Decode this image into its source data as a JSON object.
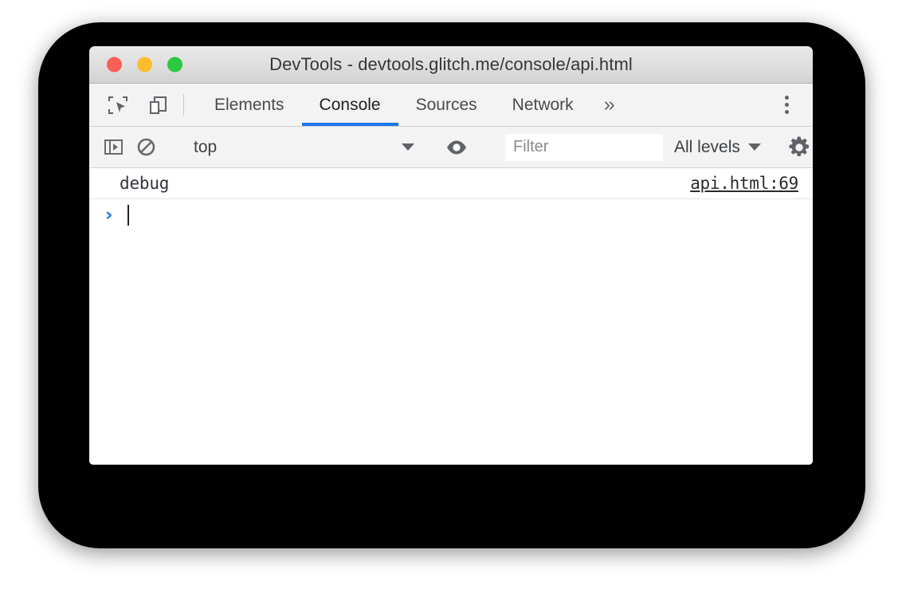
{
  "window": {
    "title": "DevTools - devtools.glitch.me/console/api.html",
    "traffic_lights": [
      {
        "name": "close",
        "color": "#fb5f56"
      },
      {
        "name": "minimize",
        "color": "#fcbc2d"
      },
      {
        "name": "maximize",
        "color": "#2bc93f"
      }
    ]
  },
  "tabbar": {
    "inspect_icon": "inspect-element-icon",
    "device_icon": "device-toolbar-icon",
    "tabs": [
      {
        "label": "Elements",
        "active": false
      },
      {
        "label": "Console",
        "active": true
      },
      {
        "label": "Sources",
        "active": false
      },
      {
        "label": "Network",
        "active": false
      }
    ],
    "more_tabs_label": "»",
    "menu_icon": "kebab-menu-icon",
    "active_underline_color": "#1a73e8"
  },
  "console_toolbar": {
    "sidebar_toggle_icon": "console-sidebar-icon",
    "clear_icon": "clear-console-icon",
    "context": "top",
    "eye_icon": "live-expression-eye-icon",
    "filter_placeholder": "Filter",
    "filter_value": "",
    "levels_label": "All levels",
    "settings_icon": "settings-gear-icon"
  },
  "console": {
    "messages": [
      {
        "text": "debug",
        "source": "api.html:69"
      }
    ],
    "prompt_symbol": "›",
    "prompt_value": ""
  }
}
